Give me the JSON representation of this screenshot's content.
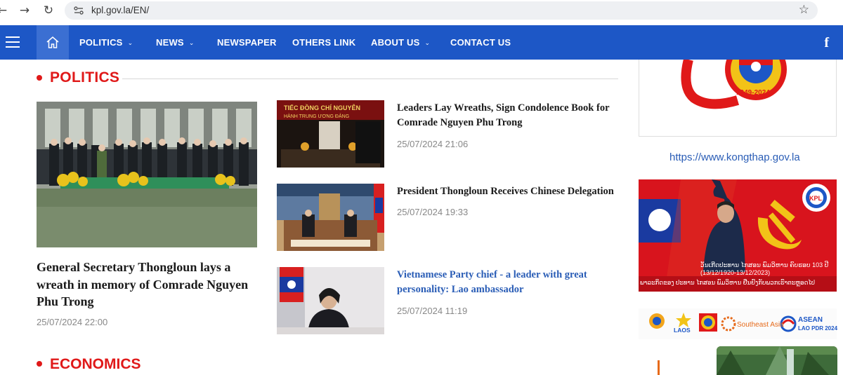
{
  "browser": {
    "url": "kpl.gov.la/EN/"
  },
  "nav": {
    "items": [
      {
        "label": "POLITICS",
        "has_dropdown": true
      },
      {
        "label": "NEWS",
        "has_dropdown": true
      },
      {
        "label": "NEWSPAPER",
        "has_dropdown": false
      },
      {
        "label": "OTHERS LINK",
        "has_dropdown": false
      },
      {
        "label": "ABOUT US",
        "has_dropdown": true
      },
      {
        "label": "CONTACT US",
        "has_dropdown": false
      }
    ],
    "facebook_glyph": "f",
    "background_color": "#1d57c6"
  },
  "politics": {
    "title": "POLITICS",
    "lead": {
      "title": "General Secretary Thongloun lays a wreath in memory of Comrade Nguyen Phu Trong",
      "date": "25/07/2024 22:00"
    },
    "articles": [
      {
        "title": "Leaders Lay Wreaths, Sign Condolence Book for Comrade Nguyen Phu Trong",
        "date": "25/07/2024 21:06",
        "link_color": false
      },
      {
        "title": "President Thongloun Receives Chinese Delegation",
        "date": "25/07/2024 19:33",
        "link_color": false
      },
      {
        "title": "Vietnamese Party chief - a leader with great personality: Lao ambassador",
        "date": "25/07/2024 11:19",
        "link_color": true
      }
    ]
  },
  "next_section": {
    "title": "ECONOMICS"
  },
  "sidebar": {
    "badge_years": "1949-2024",
    "link": "https://www.kongthap.gov.la",
    "banner_caption_1": "ວັນເກີດປະທານ ໄກສອນ ພົມວິຫານ ຄົບຮອບ 103 ປີ",
    "banner_caption_1b": "(13/12/1920-13/12/2023)",
    "banner_caption_2": "ພາລະກິດຂອງ ປະທານ ໄກສອນ ພົມວິຫານ ຢືນຢົງກັບພວກເຮົາຕະຫຼອດໄປ",
    "banner_logo_text": "KPL",
    "logos": [
      "LAOS",
      "Southeast Asia",
      "ASEAN",
      "LAO PDR 2024"
    ]
  },
  "colors": {
    "accent_red": "#e01919",
    "link_blue": "#2a5db6",
    "date_gray": "#888888"
  }
}
